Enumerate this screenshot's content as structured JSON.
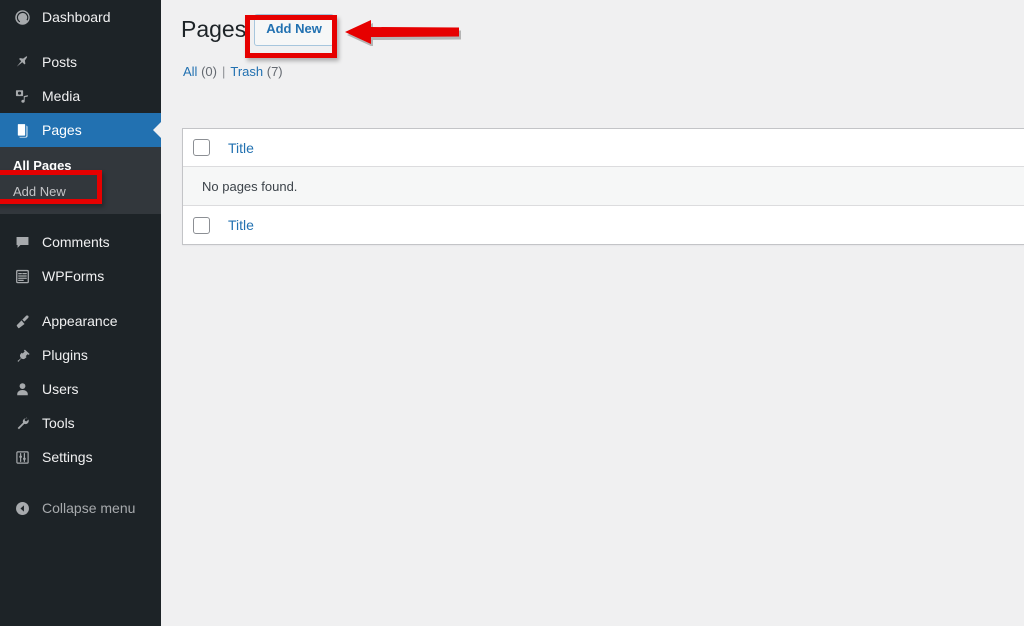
{
  "app": {
    "name": "WordPress Admin",
    "accent_blue": "#2271b1",
    "sidebar_bg": "#1d2327",
    "submenu_bg": "#32373c",
    "content_bg": "#f0f0f1",
    "annotation_color": "#e60000"
  },
  "sidebar": {
    "items": [
      {
        "label": "Dashboard",
        "icon": "dashboard-gauge-icon",
        "current": false,
        "separator_before": false
      },
      {
        "label": "Posts",
        "icon": "pushpin-icon",
        "current": false,
        "separator_before": true
      },
      {
        "label": "Media",
        "icon": "media-icon",
        "current": false,
        "separator_before": false
      },
      {
        "label": "Pages",
        "icon": "pages-icon",
        "current": true,
        "separator_before": false
      },
      {
        "label": "Comments",
        "icon": "comment-bubble-icon",
        "current": false,
        "separator_before": true
      },
      {
        "label": "WPForms",
        "icon": "wpforms-clipboard-icon",
        "current": false,
        "separator_before": false
      },
      {
        "label": "Appearance",
        "icon": "paintbrush-icon",
        "current": false,
        "separator_before": true
      },
      {
        "label": "Plugins",
        "icon": "plug-icon",
        "current": false,
        "separator_before": false
      },
      {
        "label": "Users",
        "icon": "user-icon",
        "current": false,
        "separator_before": false
      },
      {
        "label": "Tools",
        "icon": "wrench-icon",
        "current": false,
        "separator_before": false
      },
      {
        "label": "Settings",
        "icon": "sliders-icon",
        "current": false,
        "separator_before": false
      }
    ],
    "pages_submenu": [
      {
        "label": "All Pages",
        "current": true
      },
      {
        "label": "Add New",
        "current": false
      }
    ],
    "collapse": {
      "label": "Collapse menu",
      "icon": "collapse-left-arrow-icon"
    }
  },
  "main": {
    "title": "Pages",
    "add_new_label": "Add New",
    "views": {
      "all_label": "All",
      "all_count": "(0)",
      "divider": "|",
      "trash_label": "Trash",
      "trash_count": "(7)"
    },
    "table": {
      "header_title": "Title",
      "no_rows_message": "No pages found.",
      "footer_title": "Title"
    }
  },
  "annotations": [
    {
      "name": "highlight-box-add-new",
      "target": "Add New button"
    },
    {
      "name": "highlight-box-all-pages",
      "target": "All Pages submenu item"
    },
    {
      "name": "pointer-arrow",
      "target": "Add New button",
      "direction": "left"
    }
  ]
}
